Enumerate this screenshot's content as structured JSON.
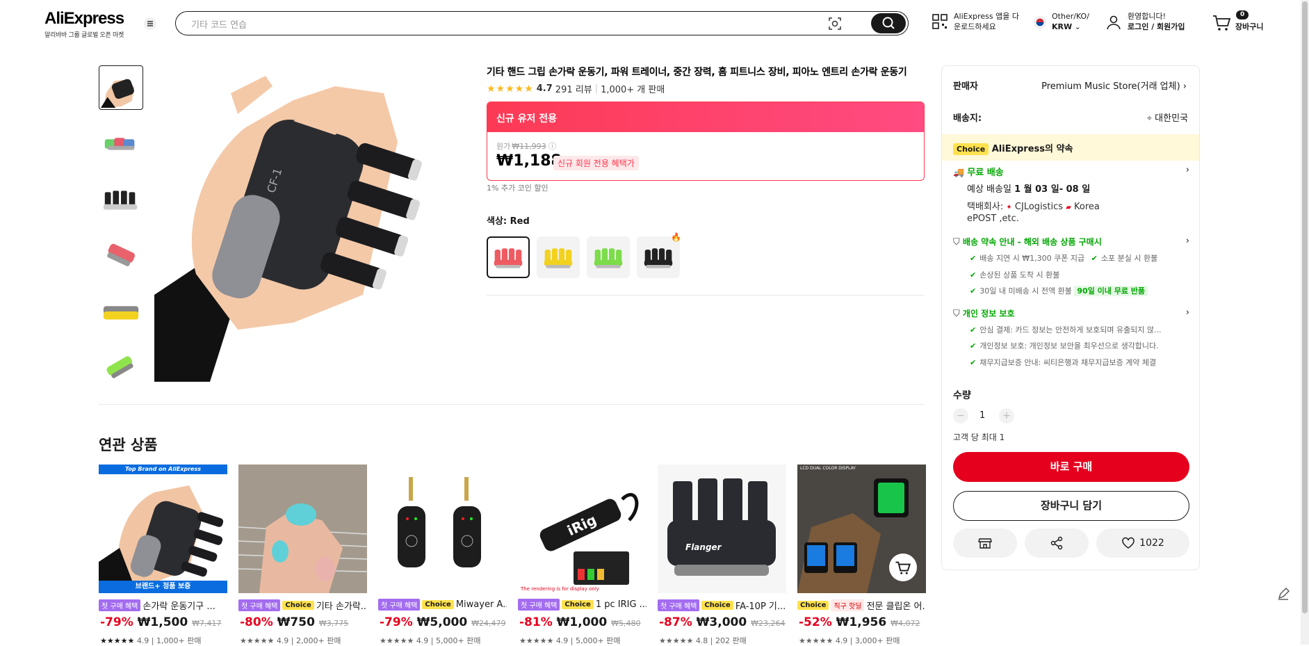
{
  "header": {
    "logo": "AliExpress",
    "logo_sub": "알리바바 그룹 글로벌 오픈 마켓",
    "search_placeholder": "기타 코드 연습",
    "app_line1": "AliExpress 앱을 다",
    "app_line2": "운로드하세요",
    "region_line1": "Other/KO/",
    "region_line2": "KRW",
    "account_line1": "환영합니다!",
    "account_line2": "로그인 / 회원가입",
    "cart_count": "0",
    "cart_label": "장바구니"
  },
  "product": {
    "title": "기타 핸드 그립 손가락 운동기, 파워 트레이너, 중간 장력, 홈 피트니스 장비, 피아노 엔트리 손가락 운동기",
    "rating": "4.7",
    "reviews": "291 리뷰",
    "sold": "1,000+ 개 판매",
    "promo_label": "신규 유저 전용",
    "orig_label": "원가",
    "orig_price": "₩11,993",
    "price": "₩1,188",
    "promo_badge": "신규 회원 전용 혜택가",
    "coin_text": "1% 추가 코인 할인",
    "color_label": "색상: Red",
    "swatches": [
      "red",
      "yellow",
      "green",
      "black"
    ]
  },
  "panel": {
    "seller_label": "판매자",
    "seller_name": "Premium Music Store(거래 업체)",
    "ship_to_label": "배송지:",
    "ship_to": "대한민국",
    "choice_tag": "Choice",
    "choice_promise": "AliExpress의 약속",
    "free_shipping": "무료 배송",
    "delivery_est_label": "예상 배송일",
    "delivery_est": "1 월 03 일- 08 일",
    "carrier_label": "택배회사:",
    "carrier1": "CJLogistics",
    "carrier2": "Korea",
    "carrier3": "ePOST ,etc.",
    "guarantee_title": "배송 약속 안내 - 해외 배송 상품 구매시",
    "guarantee1": "배송 지연 시 ₩1,300 쿠폰 지급",
    "guarantee2": "소포 분실 시 환불",
    "guarantee3": "손상된 상품 도착 시 환불",
    "guarantee4": "30일 내 미배송 시 전액 환불",
    "guarantee_badge": "90일 이내 무료 반품",
    "privacy_title": "개인 정보 보호",
    "privacy1": "안심 결제: 카드 정보는 안전하게 보호되며 유출되지 않...",
    "privacy2": "개인정보 보호: 개인정보 보안을 최우선으로 생각합니다.",
    "privacy3": "채무지급보증 안내: 씨티은행과 채무지급보증 계약 체결",
    "qty_label": "수량",
    "qty_value": "1",
    "qty_limit": "고객 당 최대 1",
    "buy_now": "바로 구매",
    "add_to_cart": "장바구니 담기",
    "wishlist_count": "1022"
  },
  "related": {
    "heading": "연관 상품",
    "items": [
      {
        "tag": "첫 구매 혜택",
        "choice": "",
        "name": "손가락 운동기구 ...",
        "discount": "-79%",
        "price": "₩1,500",
        "orig": "₩7,417",
        "rating": "4.9",
        "sold": "1,000+ 판매",
        "banner_top": "Top Brand on AliExpress",
        "banner_bottom": "브랜드+ 정품 보증"
      },
      {
        "tag": "첫 구매 혜택",
        "choice": "Choice",
        "name": "기타 손가락...",
        "discount": "-80%",
        "price": "₩750",
        "orig": "₩3,775",
        "rating": "4.9",
        "sold": "2,000+ 판매"
      },
      {
        "tag": "첫 구매 혜택",
        "choice": "Choice",
        "name": "Miwayer A...",
        "discount": "-79%",
        "price": "₩5,000",
        "orig": "₩24,479",
        "rating": "4.9",
        "sold": "5,000+ 판매"
      },
      {
        "tag": "첫 구매 혜택",
        "choice": "Choice",
        "name": "1 pc IRIG ...",
        "discount": "-81%",
        "price": "₩1,000",
        "orig": "₩5,480",
        "rating": "4.9",
        "sold": "5,000+ 판매",
        "caption": "The rendering is for display only"
      },
      {
        "tag": "첫 구매 혜택",
        "choice": "Choice",
        "name": "FA-10P 기...",
        "discount": "-87%",
        "price": "₩3,000",
        "orig": "₩23,264",
        "rating": "4.8",
        "sold": "202 판매",
        "brand": "Flanger"
      },
      {
        "tag": "",
        "choice": "Choice",
        "extra": "직구 핫딜",
        "name": "전문 클립온 어...",
        "discount": "-52%",
        "price": "₩1,956",
        "orig": "₩4,072",
        "rating": "4.9",
        "sold": "3,000+ 판매",
        "banner_top": "LCD DUAL COLOR DISPLAY"
      }
    ]
  },
  "colors": {
    "accent": "#e5001e",
    "promo": "#fd384f",
    "choice": "#ffe14d",
    "green": "#00a700"
  }
}
